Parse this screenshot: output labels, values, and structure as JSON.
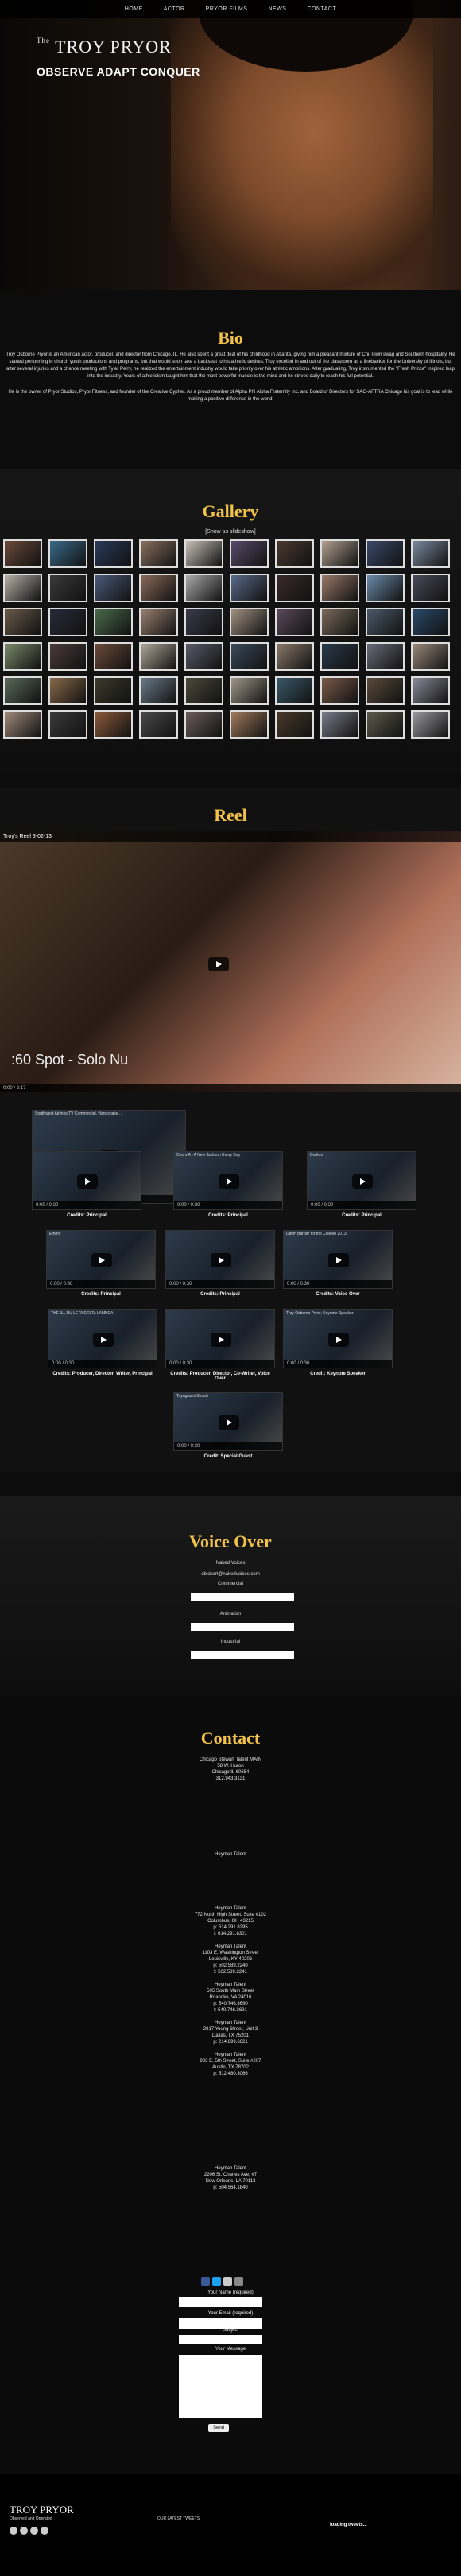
{
  "nav": [
    "HOME",
    "ACTOR",
    "PRYOR FILMS",
    "NEWS",
    "CONTACT"
  ],
  "hero": {
    "logo": "TROY PRYOR",
    "logo_sup": "The",
    "tagline": "OBSERVE ADAPT CONQUER"
  },
  "bio": {
    "title": "Bio",
    "p1": "Troy Osborne Pryor is an American actor, producer, and director from Chicago, IL. He also spent a great deal of his childhood in Atlanta, giving him a pleasant mixture of Chi-Town swag and Southern hospitality. He started performing in church youth productions and programs, but that would soon take a backseat to his athletic desires. Troy excelled in and out of the classroom as a linebacker for the University of Illinois, but after several injuries and a chance meeting with Tyler Perry, he realized the entertainment industry would take priority over his athletic ambitions. After graduating, Troy instrumented the \"Fresh Prince\" inspired leap into the industry. Years of athleticism taught him that the most powerful muscle is the mind and he strives daily to reach his full potential.",
    "p2": "He is the owner of Pryor Studios, Pryor Fitness, and founder of the Creative Cypher. As a proud member of Alpha Phi Alpha Fraternity Inc. and Board of Directors for SAG-AFTRA Chicago his goal is to lead while making a positive difference in the world."
  },
  "gallery": {
    "title": "Gallery",
    "slideshow_link": "[Show as slideshow]",
    "thumb_colors": [
      "#6b4a3a",
      "#3a6a8a",
      "#2a3a5a",
      "#8a7060",
      "#c8c0b8",
      "#5a4a6a",
      "#4a3a30",
      "#b0a090",
      "#3a4a6a",
      "#7a8aa0",
      "#b8b0a8",
      "#3a3a3a",
      "#4a5a7a",
      "#8a6a5a",
      "#aaaaaa",
      "#5a6a8a",
      "#3a2a2a",
      "#9a7a6a",
      "#6a8aaa",
      "#4a4a5a",
      "#6a5a4a",
      "#2a2a3a",
      "#4a6a4a",
      "#9a8070",
      "#3a3a4a",
      "#a09080",
      "#5a4a5a",
      "#7a6a5a",
      "#4a5a6a",
      "#2a4a6a",
      "#7a8a6a",
      "#4a3a3a",
      "#6a4a3a",
      "#b0a898",
      "#5a5a6a",
      "#3a4a5a",
      "#8a7a6a",
      "#2a3a4a",
      "#6a6a7a",
      "#9a8a7a",
      "#5a6a5a",
      "#8a6a4a",
      "#3a3a2a",
      "#6a7a8a",
      "#4a4a3a",
      "#a09888",
      "#3a5a6a",
      "#7a5a4a",
      "#5a4a3a",
      "#8a8a9a",
      "#a08a7a",
      "#3a3a3a",
      "#8a5a3a",
      "#4a4a4a",
      "#6a5a5a",
      "#a07a5a",
      "#4a3a2a",
      "#7a7a8a",
      "#5a5a4a",
      "#9a9aa0"
    ]
  },
  "reel": {
    "title": "Reel",
    "main_video_title": "Troy's Reel 3-02-13",
    "main_caption": ":60 Spot - Solo Nu",
    "videos": [
      {
        "title": "Southwest Airlines TV Commercial, Handshake ...",
        "credit": "",
        "time": "0:00 / 0:30"
      },
      {
        "title": "",
        "credit": "Credits: Principal",
        "time": "0:00 / 0:30"
      },
      {
        "title": "Coors A - A New Jackson Every Day",
        "credit": "Credits: Principal",
        "time": "0:00 / 0:30"
      },
      {
        "title": "Doritos",
        "credit": "Credits: Principal",
        "time": "0:00 / 0:30"
      },
      {
        "title": "Emmit",
        "credit": "Credits: Principal",
        "time": "0:00 / 0:30"
      },
      {
        "title": "",
        "credit": "Credits: Principal",
        "time": "0:00 / 0:30"
      },
      {
        "title": "Dawn Barber for the Colleen 2013",
        "credit": "Credits: Voice Over",
        "time": "0:00 / 0:30"
      },
      {
        "title": "THE ILL DU LETA DELTA LAMBDA",
        "credit": "Credits: Producer, Director, Writer, Principal",
        "time": "0:00 / 0:30"
      },
      {
        "title": "",
        "credit": "Credits: Producer, Director, Co-Writer, Voice Over",
        "time": "0:00 / 0:30"
      },
      {
        "title": "Troy Osborne Pryor, Keynote Speaker",
        "credit": "Credit: Keynote Speaker",
        "time": "0:00 / 0:30"
      },
      {
        "title": "Toyagrassi Sinsdy",
        "credit": "Credit: Special Guest",
        "time": "0:00 / 0:30"
      }
    ]
  },
  "voice": {
    "title": "Voice Over",
    "agent": "Naked Voices",
    "email": "dbickert@nakedvoices.com",
    "fields": [
      "Commercial",
      "Animation",
      "Industrial"
    ]
  },
  "contact": {
    "title": "Contact",
    "chicago": "Chicago Stewart Talent     MAIN\n58 W. Huron\nChicago IL 60654\n312.943.3131",
    "heyman": "Heyman Talent",
    "heyman_block": "Heyman Talent\n772 North High Street, Suite #102\nColumbus, OH 43215\np: 614.291.8295\nf: 614.291.8301\n\nHeyman Talent\n1103 E. Washington Street\nLouisville, KY 40206\np: 502.589.2240\nf: 502.589.2241\n\nHeyman Talent\n505 South Main Street\nRoanoke, VA 24016\np: 540.746.3690\nf: 540.746.3691\n\nHeyman Talent\n2817 Young Street, Unit 3\nDallas, TX 75201\np: 214.899.6621\n\nHeyman Talent\n903 E. 5th Street, Suite #207\nAustin, TX 78702\np: 512.480.3066",
    "heyman_la": "Heyman Talent\n2206 St. Charles Ave, #7\nNew Orleans, LA 70113\np: 504.564.1840",
    "form": {
      "name": "Your Name (required)",
      "email": "Your Email (required)",
      "subject": "Subject",
      "message": "Your Message",
      "send": "Send"
    }
  },
  "footer": {
    "logo": "TROY PRYOR",
    "tagline": "Observed and Operated",
    "tweets": "OUR LATEST TWEETS",
    "loading": "loading tweets..."
  },
  "colors": {
    "accent": "#f2c24b"
  }
}
